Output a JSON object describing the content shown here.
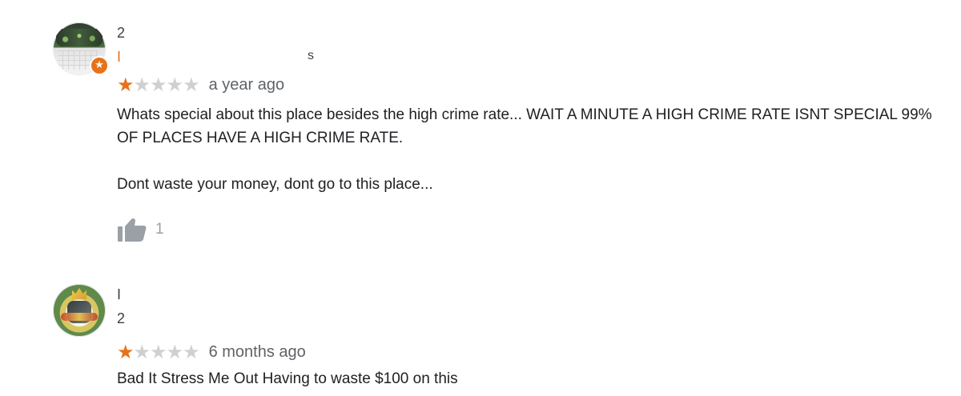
{
  "reviews": [
    {
      "reviewer": {
        "name_visible": "2",
        "subline_visible": "I",
        "subline_tail_visible": "s",
        "badge_icon": "star"
      },
      "rating": {
        "filled": 1,
        "total": 5
      },
      "time_ago": "a year ago",
      "text": "Whats special about this place besides the high crime rate... WAIT A MINUTE A HIGH CRIME RATE ISNT SPECIAL 99% OF PLACES HAVE A HIGH CRIME RATE.\n\nDont waste your money, dont go to this place...",
      "likes": "1"
    },
    {
      "reviewer": {
        "name_visible": "I",
        "subline_visible": "2"
      },
      "rating": {
        "filled": 1,
        "total": 5
      },
      "time_ago": "6 months ago",
      "text": "Bad It Stress Me Out Having to waste $100 on this"
    }
  ],
  "icons": {
    "thumbs_up": "thumbs-up-icon",
    "local_guide": "star-icon"
  },
  "colors": {
    "accent": "#e8711a",
    "star_empty": "#d0d0d0",
    "meta_gray": "#5f6368",
    "icon_gray": "#9aa0a6"
  }
}
